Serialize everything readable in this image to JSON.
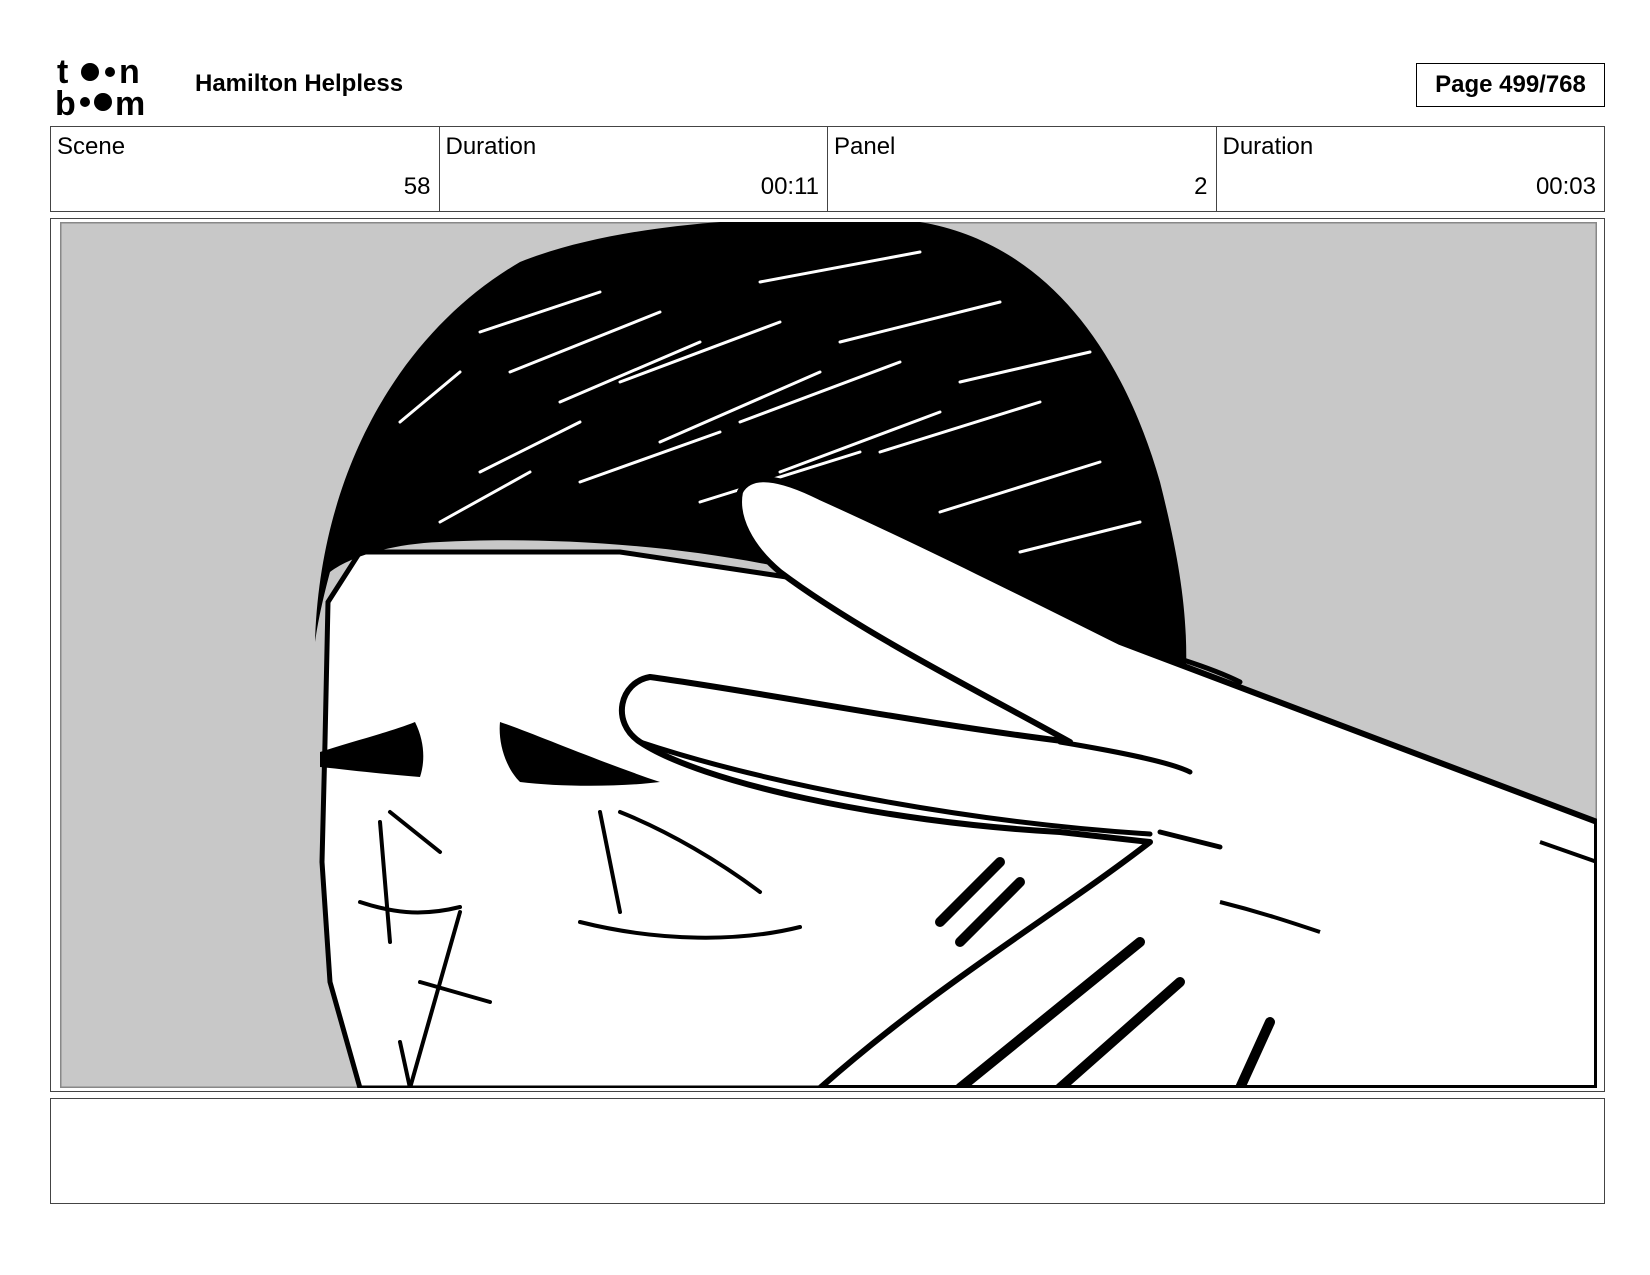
{
  "header": {
    "project_title": "Hamilton Helpless",
    "page_label": "Page 499/768"
  },
  "info": {
    "scene_label": "Scene",
    "scene_value": "58",
    "scene_duration_label": "Duration",
    "scene_duration_value": "00:11",
    "panel_label": "Panel",
    "panel_value": "2",
    "panel_duration_label": "Duration",
    "panel_duration_value": "00:03"
  },
  "caption": {
    "text": ""
  },
  "colors": {
    "background": "#c8c8c8",
    "ink": "#000000"
  }
}
